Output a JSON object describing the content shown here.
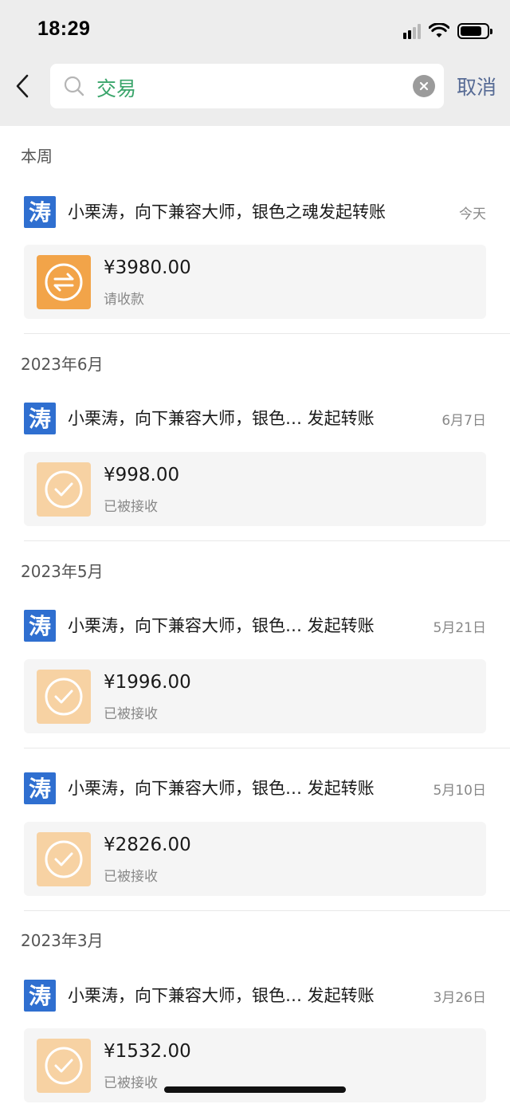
{
  "status_bar": {
    "time": "18:29"
  },
  "search": {
    "query": "交易",
    "cancel_label": "取消"
  },
  "sections": [
    {
      "header": "本周",
      "items": [
        {
          "avatar_char": "涛",
          "title": "小栗涛，向下兼容大师，银色之魂发起转账",
          "date": "今天",
          "amount": "¥3980.00",
          "status": "请收款",
          "state": "pending"
        }
      ]
    },
    {
      "header": "2023年6月",
      "items": [
        {
          "avatar_char": "涛",
          "title": "小栗涛，向下兼容大师，银色…  发起转账",
          "date": "6月7日",
          "amount": "¥998.00",
          "status": "已被接收",
          "state": "received"
        }
      ]
    },
    {
      "header": "2023年5月",
      "items": [
        {
          "avatar_char": "涛",
          "title": "小栗涛，向下兼容大师，银色… 发起转账",
          "date": "5月21日",
          "amount": "¥1996.00",
          "status": "已被接收",
          "state": "received"
        },
        {
          "avatar_char": "涛",
          "title": "小栗涛，向下兼容大师，银色… 发起转账",
          "date": "5月10日",
          "amount": "¥2826.00",
          "status": "已被接收",
          "state": "received"
        }
      ]
    },
    {
      "header": "2023年3月",
      "items": [
        {
          "avatar_char": "涛",
          "title": "小栗涛，向下兼容大师，银色… 发起转账",
          "date": "3月26日",
          "amount": "¥1532.00",
          "status": "已被接收",
          "state": "received"
        }
      ]
    }
  ],
  "colors": {
    "accent_orange": "#f2a449",
    "done_orange": "#f7d2a3",
    "link_blue": "#576b95",
    "search_green": "#3aa56b",
    "avatar_blue": "#2f6fd0"
  }
}
